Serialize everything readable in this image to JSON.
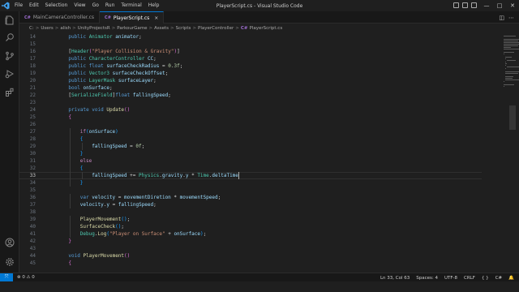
{
  "window": {
    "title": "PlayerScript.cs - Visual Studio Code",
    "menu": [
      "File",
      "Edit",
      "Selection",
      "View",
      "Go",
      "Run",
      "Terminal",
      "Help"
    ]
  },
  "tabs": [
    {
      "label": "MainCameraController.cs",
      "active": false
    },
    {
      "label": "PlayerScript.cs",
      "active": true,
      "close": "×"
    }
  ],
  "breadcrumb": [
    "C:",
    "Users",
    "alish",
    "UnityProjectsR",
    "ParkourGame",
    "Assets",
    "Scripts",
    "PlayerController",
    "PlayerScript.cs"
  ],
  "editor": {
    "current_line": "33",
    "lines": [
      {
        "n": "14",
        "indent": 1,
        "tokens": [
          [
            "k",
            "public "
          ],
          [
            "t",
            "Animator "
          ],
          [
            "v",
            "animator"
          ],
          [
            "p",
            ";"
          ]
        ]
      },
      {
        "n": "15",
        "indent": 0,
        "tokens": []
      },
      {
        "n": "16",
        "indent": 1,
        "tokens": [
          [
            "p",
            "["
          ],
          [
            "t",
            "Header"
          ],
          [
            "b2",
            "("
          ],
          [
            "s",
            "\"Player Collision & Gravity\""
          ],
          [
            "b2",
            ")"
          ],
          [
            "p",
            "]"
          ]
        ]
      },
      {
        "n": "17",
        "indent": 1,
        "tokens": [
          [
            "k",
            "public "
          ],
          [
            "t",
            "CharacterController "
          ],
          [
            "v",
            "CC"
          ],
          [
            "p",
            ";"
          ]
        ]
      },
      {
        "n": "18",
        "indent": 1,
        "tokens": [
          [
            "k",
            "public float "
          ],
          [
            "v",
            "surfaceCheckRadius"
          ],
          [
            "p",
            " = "
          ],
          [
            "n",
            "0.3f"
          ],
          [
            "p",
            ";"
          ]
        ]
      },
      {
        "n": "19",
        "indent": 1,
        "tokens": [
          [
            "k",
            "public "
          ],
          [
            "t",
            "Vector3 "
          ],
          [
            "v",
            "surfaceCheckOffset"
          ],
          [
            "p",
            ";"
          ]
        ]
      },
      {
        "n": "20",
        "indent": 1,
        "tokens": [
          [
            "k",
            "public "
          ],
          [
            "t",
            "LayerMask "
          ],
          [
            "v",
            "surfaceLayer"
          ],
          [
            "p",
            ";"
          ]
        ]
      },
      {
        "n": "21",
        "indent": 1,
        "tokens": [
          [
            "k",
            "bool "
          ],
          [
            "v",
            "onSurface"
          ],
          [
            "p",
            ";"
          ]
        ]
      },
      {
        "n": "22",
        "indent": 1,
        "tokens": [
          [
            "p",
            "["
          ],
          [
            "t",
            "SerializeField"
          ],
          [
            "p",
            "]"
          ],
          [
            "k",
            "float "
          ],
          [
            "v",
            "fallingSpeed"
          ],
          [
            "p",
            ";"
          ]
        ]
      },
      {
        "n": "23",
        "indent": 0,
        "tokens": []
      },
      {
        "n": "24",
        "indent": 1,
        "tokens": [
          [
            "k",
            "private void "
          ],
          [
            "f",
            "Update"
          ],
          [
            "b2",
            "()"
          ]
        ]
      },
      {
        "n": "25",
        "indent": 1,
        "tokens": [
          [
            "b2",
            "{"
          ]
        ]
      },
      {
        "n": "26",
        "indent": 0,
        "tokens": []
      },
      {
        "n": "27",
        "indent": 2,
        "tokens": [
          [
            "c",
            "if"
          ],
          [
            "b3",
            "("
          ],
          [
            "v",
            "onSurface"
          ],
          [
            "b3",
            ")"
          ]
        ]
      },
      {
        "n": "28",
        "indent": 2,
        "tokens": [
          [
            "b3",
            "{"
          ]
        ]
      },
      {
        "n": "29",
        "indent": 3,
        "tokens": [
          [
            "v",
            "fallingSpeed"
          ],
          [
            "p",
            " = "
          ],
          [
            "n",
            "0f"
          ],
          [
            "p",
            ";"
          ]
        ]
      },
      {
        "n": "30",
        "indent": 2,
        "tokens": [
          [
            "b3",
            "}"
          ]
        ]
      },
      {
        "n": "31",
        "indent": 2,
        "tokens": [
          [
            "c",
            "else"
          ]
        ]
      },
      {
        "n": "32",
        "indent": 2,
        "tokens": [
          [
            "b3",
            "{"
          ]
        ]
      },
      {
        "n": "33",
        "indent": 3,
        "tokens": [
          [
            "v",
            "fallingSpeed"
          ],
          [
            "p",
            " += "
          ],
          [
            "t",
            "Physics"
          ],
          [
            "p",
            "."
          ],
          [
            "v",
            "gravity"
          ],
          [
            "p",
            "."
          ],
          [
            "v",
            "y"
          ],
          [
            "p",
            " * "
          ],
          [
            "t",
            "Time"
          ],
          [
            "p",
            "."
          ],
          [
            "v",
            "deltaTime"
          ]
        ]
      },
      {
        "n": "34",
        "indent": 2,
        "tokens": [
          [
            "b3",
            "}"
          ]
        ]
      },
      {
        "n": "35",
        "indent": 0,
        "tokens": []
      },
      {
        "n": "36",
        "indent": 2,
        "tokens": [
          [
            "k",
            "var "
          ],
          [
            "v",
            "velocity"
          ],
          [
            "p",
            " = "
          ],
          [
            "v",
            "movementDiretion"
          ],
          [
            "p",
            " * "
          ],
          [
            "v",
            "movementSpeed"
          ],
          [
            "p",
            ";"
          ]
        ]
      },
      {
        "n": "37",
        "indent": 2,
        "tokens": [
          [
            "v",
            "velocity"
          ],
          [
            "p",
            "."
          ],
          [
            "v",
            "y"
          ],
          [
            "p",
            " = "
          ],
          [
            "v",
            "fallingSpeed"
          ],
          [
            "p",
            ";"
          ]
        ]
      },
      {
        "n": "38",
        "indent": 0,
        "tokens": []
      },
      {
        "n": "39",
        "indent": 2,
        "tokens": [
          [
            "f",
            "PlayerMovement"
          ],
          [
            "b3",
            "()"
          ],
          [
            "p",
            ";"
          ]
        ]
      },
      {
        "n": "40",
        "indent": 2,
        "tokens": [
          [
            "f",
            "SurfaceCheck"
          ],
          [
            "b3",
            "()"
          ],
          [
            "p",
            ";"
          ]
        ]
      },
      {
        "n": "41",
        "indent": 2,
        "tokens": [
          [
            "t",
            "Debug"
          ],
          [
            "p",
            "."
          ],
          [
            "f",
            "Log"
          ],
          [
            "b3",
            "("
          ],
          [
            "s",
            "\"Player on Surface\""
          ],
          [
            "p",
            " + "
          ],
          [
            "v",
            "onSurface"
          ],
          [
            "b3",
            ")"
          ],
          [
            "p",
            ";"
          ]
        ]
      },
      {
        "n": "42",
        "indent": 1,
        "tokens": [
          [
            "b2",
            "}"
          ]
        ]
      },
      {
        "n": "43",
        "indent": 0,
        "tokens": []
      },
      {
        "n": "44",
        "indent": 1,
        "tokens": [
          [
            "k",
            "void "
          ],
          [
            "f",
            "PlayerMovement"
          ],
          [
            "b2",
            "()"
          ]
        ]
      },
      {
        "n": "45",
        "indent": 1,
        "tokens": [
          [
            "b2",
            "{"
          ]
        ]
      }
    ]
  },
  "status": {
    "errors": "0",
    "warnings": "0",
    "position": "Ln 33, Col 63",
    "spaces": "Spaces: 4",
    "encoding": "UTF-8",
    "eol": "CRLF",
    "language": "C#"
  },
  "colors": {
    "accent": "#0078d4",
    "background": "#1f1f1f",
    "keyword": "#569cd6",
    "type": "#4ec9b0",
    "variable": "#9cdcfe",
    "string": "#ce9178"
  },
  "icons": [
    "vscode-logo-icon",
    "explorer-icon",
    "search-icon",
    "source-control-icon",
    "run-debug-icon",
    "extensions-icon",
    "account-icon",
    "settings-gear-icon",
    "remote-icon"
  ]
}
